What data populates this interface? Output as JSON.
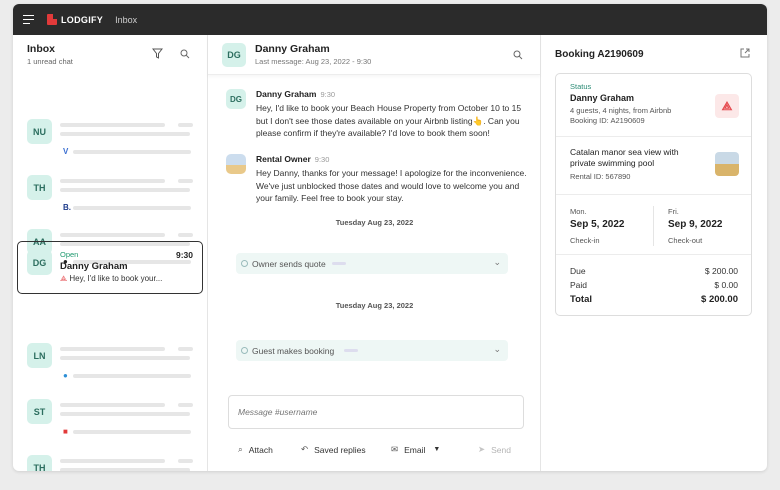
{
  "topbar": {
    "logo": "LODGIFY",
    "section": "Inbox"
  },
  "inbox": {
    "title": "Inbox",
    "subtitle": "1 unread chat",
    "chats": [
      {
        "initials": "NU",
        "source": "V"
      },
      {
        "initials": "TH",
        "source": "B."
      },
      {
        "initials": "AA",
        "source": "●"
      },
      {
        "initials": "LN",
        "source": "●"
      },
      {
        "initials": "ST",
        "source": "■"
      },
      {
        "initials": "TH",
        "source": "⟁"
      }
    ],
    "selected": {
      "initials": "DG",
      "status": "Open",
      "name": "Danny Graham",
      "time": "9:30",
      "preview": "Hey, I'd like to book your..."
    }
  },
  "conversation": {
    "initials": "DG",
    "name": "Danny Graham",
    "last_message": "Last message: Aug 23, 2022 - 9:30",
    "messages": [
      {
        "initials": "DG",
        "sender": "Danny Graham",
        "time": "9:30",
        "text": "Hey, I'd like to book your Beach House Property from October 10 to 15 but I don't see those dates available on your Airbnb listing👆. Can you please confirm if they're available? I'd love to book them soon!"
      },
      {
        "sender": "Rental Owner",
        "time": "9:30",
        "text": "Hey Danny, thanks for your message! I apologize for the inconvenience. We've just unblocked those dates and would love to welcome you and your family. Feel free to book your stay."
      }
    ],
    "date1": "Tuesday Aug 23, 2022",
    "event1": "Owner sends quote",
    "date2": "Tuesday Aug 23, 2022",
    "event2": "Guest makes booking",
    "composer_placeholder": "Message #username",
    "toolbar": {
      "attach": "Attach",
      "saved": "Saved replies",
      "email": "Email",
      "send": "Send"
    }
  },
  "booking": {
    "title": "Booking A2190609",
    "status_label": "Status",
    "guest": "Danny Graham",
    "guest_meta": "4 guests, 4 nights, from Airbnb",
    "booking_id": "Booking ID: A2190609",
    "rental_name": "Catalan manor sea view with private swimming pool",
    "rental_id": "Rental ID: 567890",
    "checkin_day": "Mon.",
    "checkin_date": "Sep 5, 2022",
    "checkin_label": "Check-in",
    "checkout_day": "Fri.",
    "checkout_date": "Sep 9, 2022",
    "checkout_label": "Check-out",
    "due_label": "Due",
    "due_value": "$ 200.00",
    "paid_label": "Paid",
    "paid_value": "$ 0.00",
    "total_label": "Total",
    "total_value": "$ 200.00"
  }
}
